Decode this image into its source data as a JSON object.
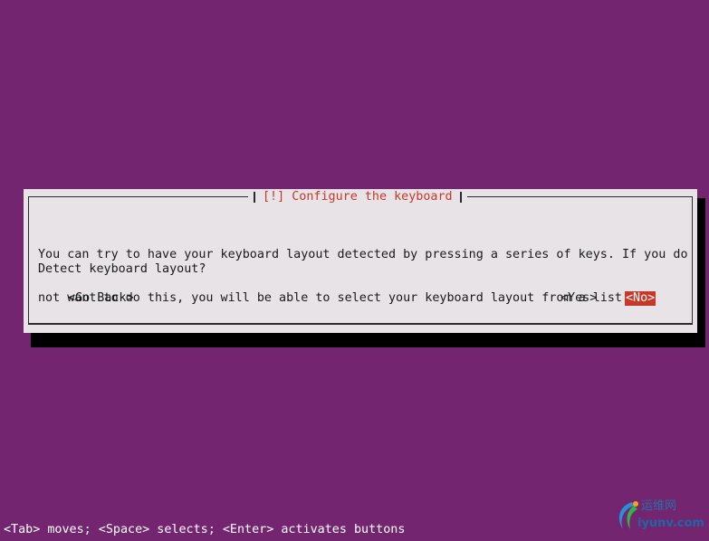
{
  "screen": {
    "background_color": "#732570"
  },
  "dialog": {
    "title": "[!] Configure the keyboard",
    "description_lines": [
      "You can try to have your keyboard layout detected by pressing a series of keys. If you do",
      "not want to do this, you will be able to select your keyboard layout from a list."
    ],
    "question": "Detect keyboard layout?",
    "buttons": {
      "go_back": "<Go Back>",
      "yes": "<Yes>",
      "no": "<No>"
    },
    "selected_button": "no",
    "colors": {
      "title": "#c6382a",
      "selected_button_bg": "#c7382a",
      "dialog_bg": "#e7e3e6"
    }
  },
  "status_bar": {
    "text": "<Tab> moves; <Space> selects; <Enter> activates buttons"
  },
  "watermark": {
    "line1": "运维网",
    "line2": "iyunv.com"
  }
}
